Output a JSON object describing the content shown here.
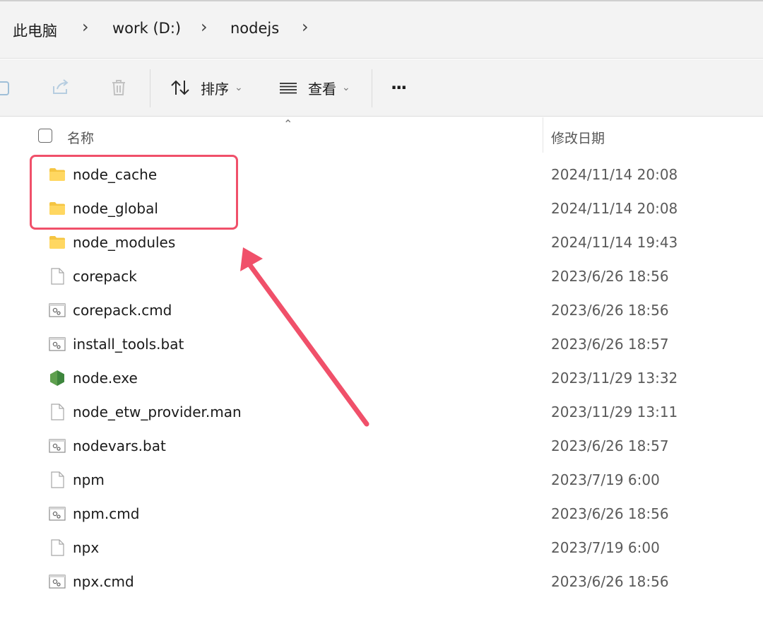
{
  "breadcrumb": {
    "items": [
      "此电脑",
      "work (D:)",
      "nodejs"
    ],
    "separator": "›"
  },
  "toolbar": {
    "sort_label": "排序",
    "view_label": "查看",
    "more_label": "···"
  },
  "columns": {
    "name": "名称",
    "modified": "修改日期"
  },
  "files": [
    {
      "name": "node_cache",
      "date": "2024/11/14 20:08",
      "icon": "folder-icon"
    },
    {
      "name": "node_global",
      "date": "2024/11/14 20:08",
      "icon": "folder-icon"
    },
    {
      "name": "node_modules",
      "date": "2024/11/14 19:43",
      "icon": "folder-icon"
    },
    {
      "name": "corepack",
      "date": "2023/6/26 18:56",
      "icon": "file-icon"
    },
    {
      "name": "corepack.cmd",
      "date": "2023/6/26 18:56",
      "icon": "script-icon"
    },
    {
      "name": "install_tools.bat",
      "date": "2023/6/26 18:57",
      "icon": "script-icon"
    },
    {
      "name": "node.exe",
      "date": "2023/11/29 13:32",
      "icon": "nodejs-icon"
    },
    {
      "name": "node_etw_provider.man",
      "date": "2023/11/29 13:11",
      "icon": "file-icon"
    },
    {
      "name": "nodevars.bat",
      "date": "2023/6/26 18:57",
      "icon": "script-icon"
    },
    {
      "name": "npm",
      "date": "2023/7/19 6:00",
      "icon": "file-icon"
    },
    {
      "name": "npm.cmd",
      "date": "2023/6/26 18:56",
      "icon": "script-icon"
    },
    {
      "name": "npx",
      "date": "2023/7/19 6:00",
      "icon": "file-icon"
    },
    {
      "name": "npx.cmd",
      "date": "2023/6/26 18:56",
      "icon": "script-icon"
    }
  ],
  "annotation": {
    "color": "#f0506a"
  }
}
